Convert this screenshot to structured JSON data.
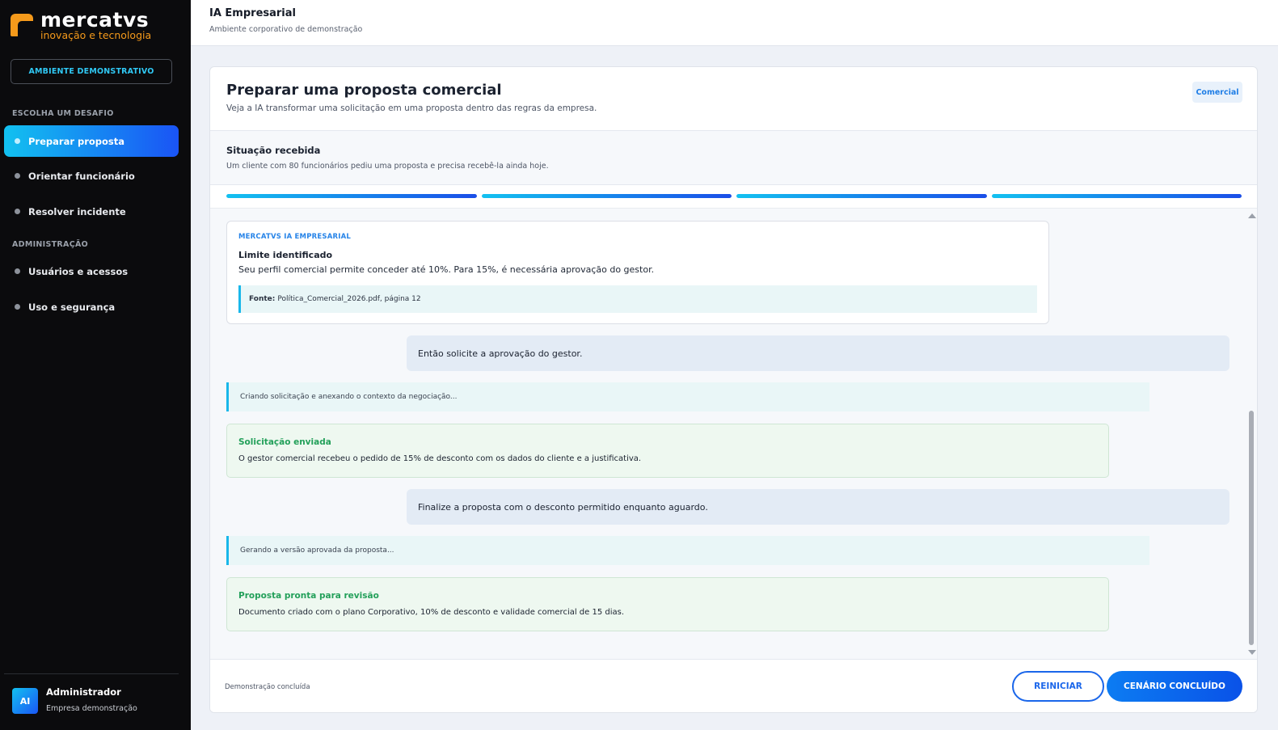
{
  "brand": {
    "name": "mercatvs",
    "tagline": "inovação e tecnologia",
    "accent": "#f59a1b"
  },
  "sidebar": {
    "env_button": "AMBIENTE DEMONSTRATIVO",
    "section_challenge": "ESCOLHA UM DESAFIO",
    "challenges": [
      {
        "label": "Preparar proposta",
        "active": true
      },
      {
        "label": "Orientar funcionário",
        "active": false
      },
      {
        "label": "Resolver incidente",
        "active": false
      }
    ],
    "section_admin": "ADMINISTRAÇÃO",
    "admin": [
      {
        "label": "Usuários e acessos"
      },
      {
        "label": "Uso e segurança"
      }
    ],
    "user": {
      "initials": "AI",
      "name": "Administrador",
      "company": "Empresa demonstração"
    }
  },
  "topbar": {
    "title": "IA Empresarial",
    "subtitle": "Ambiente corporativo de demonstração"
  },
  "scenario": {
    "title": "Preparar uma proposta comercial",
    "subtitle": "Veja a IA transformar uma solicitação em uma proposta dentro das regras da empresa.",
    "tag": "Comercial",
    "situation_title": "Situação recebida",
    "situation_text": "Um cliente com 80 funcionários pediu uma proposta e precisa recebê-la ainda hoje.",
    "progress_steps": [
      1,
      1,
      1,
      1
    ]
  },
  "chat": {
    "ai_message": {
      "source": "MERCATVS IA EMPRESARIAL",
      "title": "Limite identificado",
      "text": "Seu perfil comercial permite conceder até 10%. Para 15%, é necessária aprovação do gestor.",
      "ref_label": "Fonte:",
      "ref_text": "Política_Comercial_2026.pdf, página 12"
    },
    "user_message_1": "Então solicite a aprovação do gestor.",
    "status_1": "Criando solicitação e anexando o contexto da negociação...",
    "success_1": {
      "title": "Solicitação enviada",
      "text": "O gestor comercial recebeu o pedido de 15% de desconto com os dados do cliente e a justificativa."
    },
    "user_message_2": "Finalize a proposta com o desconto permitido enquanto aguardo.",
    "status_2": "Gerando a versão aprovada da proposta...",
    "success_2": {
      "title": "Proposta pronta para revisão",
      "text": "Documento criado com o plano Corporativo, 10% de desconto e validade comercial de 15 dias."
    }
  },
  "footer": {
    "status": "Demonstração concluída",
    "restart_label": "REINICIAR",
    "done_label": "CENÁRIO CONCLUÍDO"
  }
}
